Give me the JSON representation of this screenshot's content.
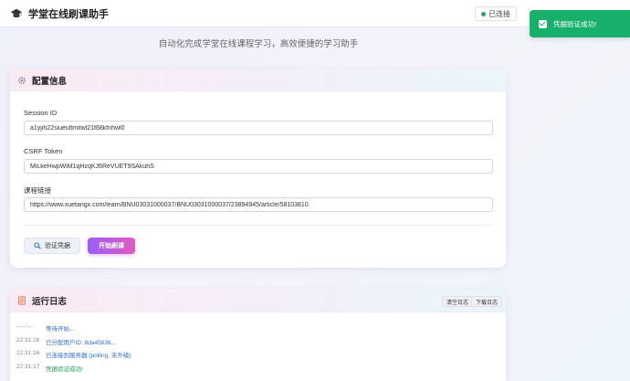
{
  "header": {
    "title": "学堂在线刷课助手",
    "status": "已连接"
  },
  "subtitle": "自动化完成学堂在线课程学习，高效便捷的学习助手",
  "toast": {
    "message": "凭据验证成功!"
  },
  "config": {
    "title": "配置信息",
    "session_label": "Session ID",
    "session_value": "a1yjih22siueultmitwl21f68kfnhwl0",
    "csrf_label": "CSRF Token",
    "csrf_value": "MiLkeHwpWiM1qHzqKJ6ReVUET9SAkuhS",
    "course_label": "课程链接",
    "course_value": "https://www.xuetangx.com/learn/BNU03031000037/BNU03031000037/23894945/article/58103810",
    "verify_label": "验证凭据",
    "start_label": "开始刷课"
  },
  "log": {
    "title": "运行日志",
    "clear_label": "清空日志",
    "download_label": "下载日志",
    "entries": [
      {
        "time": "--:--:--",
        "message": "等待开始..."
      },
      {
        "time": "22:31:16",
        "message": "已分配用户ID: 8da45836..."
      },
      {
        "time": "22:31:16",
        "message": "已连接到服务器 (polling, 未升级)"
      },
      {
        "time": "22:31:17",
        "message": "凭据验证成功!"
      }
    ]
  },
  "colors": {
    "success": "#17b06b",
    "accent_start": "#9b5cf5",
    "accent_end": "#e05bc1",
    "log_info": "#2f6fe0"
  }
}
